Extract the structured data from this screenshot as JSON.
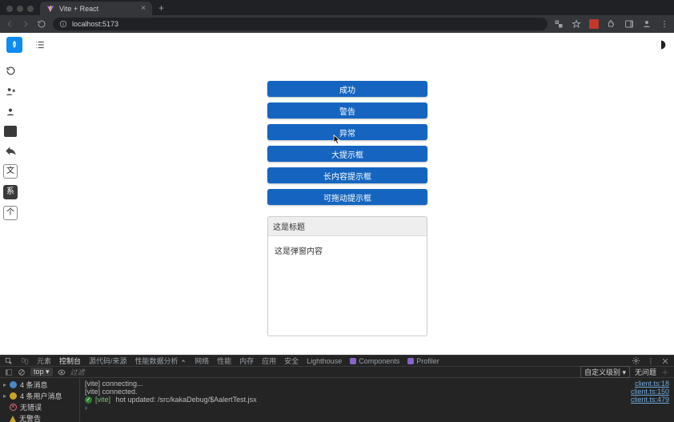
{
  "browser": {
    "tab_title": "Vite + React",
    "url": "localhost:5173",
    "new_tab_glyph": "+",
    "close_glyph": "×"
  },
  "app": {
    "buttons": [
      "成功",
      "警告",
      "异常",
      "大提示框",
      "长内容提示框",
      "可拖动提示框"
    ],
    "panel_title": "这是标题",
    "panel_body": "这是弹窗内容",
    "rail_text_items": [
      "文",
      "系",
      "个"
    ]
  },
  "devtools": {
    "tabs": {
      "elements": "元素",
      "console": "控制台",
      "sources": "源代码/来源",
      "performance": "性能数据分析",
      "network": "网络",
      "perf": "性能",
      "memory": "内存",
      "application": "应用",
      "security": "安全",
      "lighthouse": "Lighthouse",
      "components": "Components",
      "profiler": "Profiler"
    },
    "subbar": {
      "context": "top",
      "filter_placeholder": "过滤",
      "levels": "自定义级别",
      "issues": "无问题"
    },
    "sidebar": {
      "messages": "4 条消息",
      "user_messages": "4 条用户消息",
      "no_errors": "无错误",
      "no_warnings": "无警告"
    },
    "log": {
      "l1": "[vite] connecting...",
      "l2": "[vite] connected.",
      "l3_prefix": "[vite]",
      "l3_rest": " hot updated: /src/kakaDebug/$AalertTest.jsx",
      "src1": "client.ts:18",
      "src2": "client.ts:150",
      "src3": "client.ts:479"
    }
  }
}
